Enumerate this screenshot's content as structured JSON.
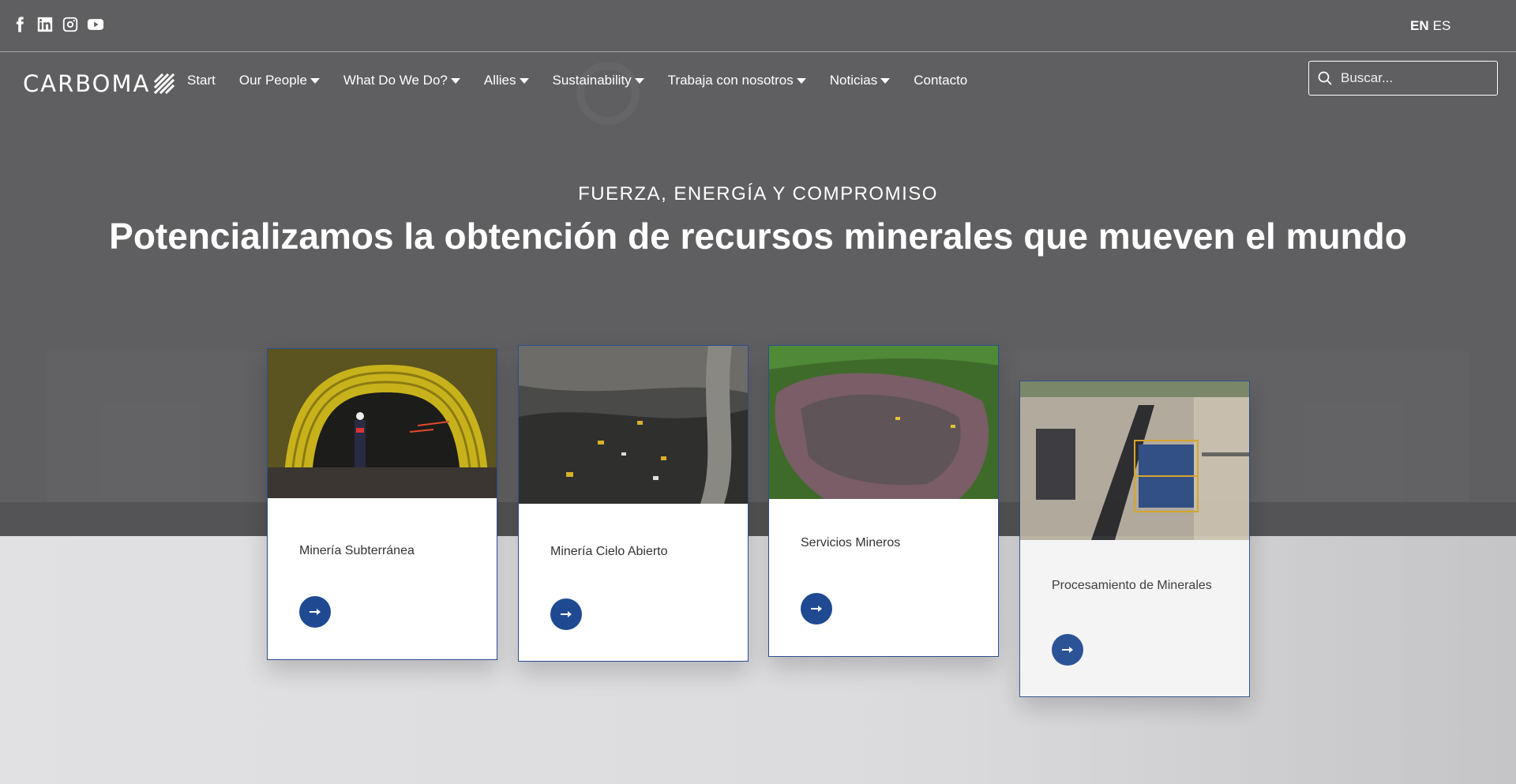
{
  "social": [
    "facebook-icon",
    "linkedin-icon",
    "instagram-icon",
    "youtube-icon"
  ],
  "lang": {
    "en": "EN",
    "es": "ES"
  },
  "logo": {
    "text": "CARBOMA"
  },
  "nav": {
    "items": [
      {
        "label": "Start",
        "dropdown": false
      },
      {
        "label": "Our People",
        "dropdown": true
      },
      {
        "label": "What Do We Do?",
        "dropdown": true
      },
      {
        "label": "Allies",
        "dropdown": true
      },
      {
        "label": "Sustainability",
        "dropdown": true
      },
      {
        "label": "Trabaja con nosotros",
        "dropdown": true
      },
      {
        "label": "Noticias",
        "dropdown": true
      },
      {
        "label": "Contacto",
        "dropdown": false
      }
    ]
  },
  "search": {
    "placeholder": "Buscar...",
    "value": ""
  },
  "hero": {
    "eyebrow": "FUERZA, ENERGÍA Y COMPROMISO",
    "headline": "Potencializamos la obtención de recursos minerales que mueven el mundo"
  },
  "cards": [
    {
      "title": "Minería Subterránea",
      "image": "underground-tunnel-photo"
    },
    {
      "title": "Minería Cielo Abierto",
      "image": "open-pit-mine-photo"
    },
    {
      "title": "Servicios Mineros",
      "image": "aerial-mining-site-photo"
    },
    {
      "title": "Procesamiento de Minerales",
      "image": "mineral-processing-plant-photo"
    }
  ],
  "colors": {
    "accent": "#1f4a92",
    "hero_bg": "#5f5f61",
    "lower_bg": "#dedede"
  }
}
